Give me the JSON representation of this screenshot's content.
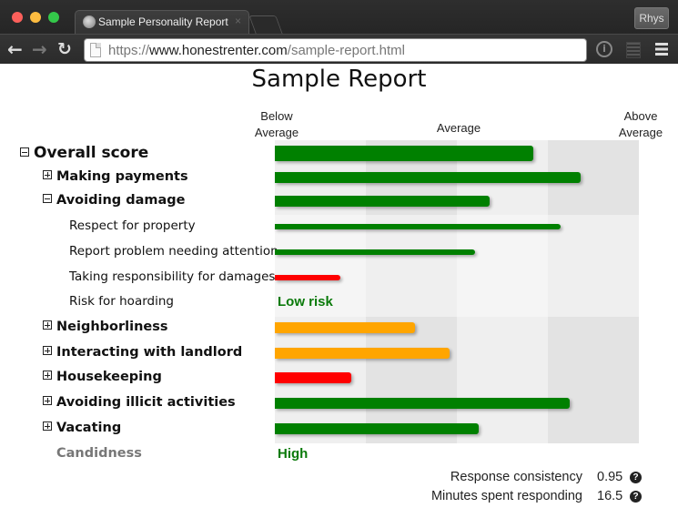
{
  "browser": {
    "tab_title": "Sample Personality Report",
    "tab_close": "×",
    "profile_name": "Rhys",
    "url_scheme": "https://",
    "url_host": "www.honestrenter.com",
    "url_path": "/sample-report.html",
    "nav": {
      "back": "🡐",
      "forward": "🡒",
      "reload": "↻"
    },
    "icons": {
      "info": "i"
    }
  },
  "report": {
    "title": "Sample Report",
    "axis": {
      "below": "Below Average",
      "average": "Average",
      "above": "Above Average"
    },
    "colors": {
      "green": "#008000",
      "orange": "#ffa500",
      "red": "#ff0000",
      "text_green": "#0a7a0a"
    },
    "rows": [
      {
        "label": "Overall score",
        "level": 0,
        "toggle": "minus",
        "score": 0.71,
        "color": "#008000"
      },
      {
        "label": "Making payments",
        "level": 1,
        "toggle": "plus",
        "score": 0.84,
        "color": "#008000"
      },
      {
        "label": "Avoiding damage",
        "level": 1,
        "toggle": "minus",
        "score": 0.59,
        "color": "#008000"
      },
      {
        "label": "Respect for property",
        "level": 2,
        "score": 0.785,
        "color": "#008000"
      },
      {
        "label": "Report problem needing attention",
        "level": 2,
        "score": 0.55,
        "color": "#008000"
      },
      {
        "label": "Taking responsibility for damages",
        "level": 2,
        "score": 0.18,
        "color": "#ff0000"
      },
      {
        "label": "Risk for hoarding",
        "level": 2,
        "text_value": "Low risk"
      },
      {
        "label": "Neighborliness",
        "level": 1,
        "toggle": "plus",
        "score": 0.385,
        "color": "#ffa500"
      },
      {
        "label": "Interacting with landlord",
        "level": 1,
        "toggle": "plus",
        "score": 0.48,
        "color": "#ffa500"
      },
      {
        "label": "Housekeeping",
        "level": 1,
        "toggle": "plus",
        "score": 0.21,
        "color": "#ff0000"
      },
      {
        "label": "Avoiding illicit activities",
        "level": 1,
        "toggle": "plus",
        "score": 0.81,
        "color": "#008000"
      },
      {
        "label": "Vacating",
        "level": 1,
        "toggle": "plus",
        "score": 0.56,
        "color": "#008000"
      },
      {
        "label": "Candidness",
        "level": 1,
        "muted": true,
        "text_value": "High"
      }
    ],
    "stats": [
      {
        "label": "Response consistency",
        "value": "0.95",
        "help": "?"
      },
      {
        "label": "Minutes spent responding",
        "value": "16.5",
        "help": "?"
      }
    ]
  }
}
